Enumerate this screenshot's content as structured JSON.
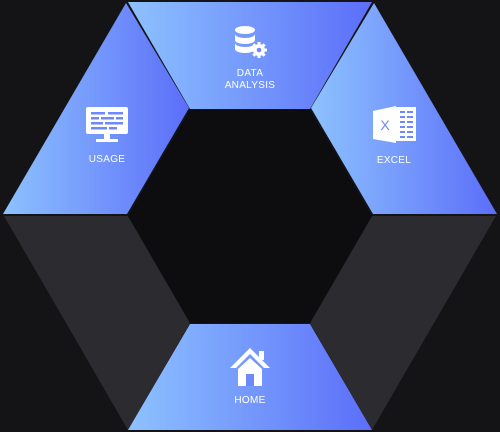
{
  "menu": {
    "segments": [
      {
        "id": "data-analysis",
        "label_line1": "DATA",
        "label_line2": "ANALYSIS",
        "icon": "database-gear-icon",
        "active": true
      },
      {
        "id": "excel",
        "label": "EXCEL",
        "icon": "excel-icon",
        "active": true
      },
      {
        "id": "usage",
        "label": "USAGE",
        "icon": "monitor-icon",
        "active": true
      },
      {
        "id": "home",
        "label": "HOME",
        "icon": "home-icon",
        "active": true
      },
      {
        "id": "left-inactive",
        "active": false
      },
      {
        "id": "right-inactive",
        "active": false
      }
    ]
  },
  "colors": {
    "background": "#141416",
    "inactive": "#2b2b30",
    "center": "#0d0d0f",
    "gradient_start": "#8dc2ff",
    "gradient_end": "#5c6ef9"
  }
}
